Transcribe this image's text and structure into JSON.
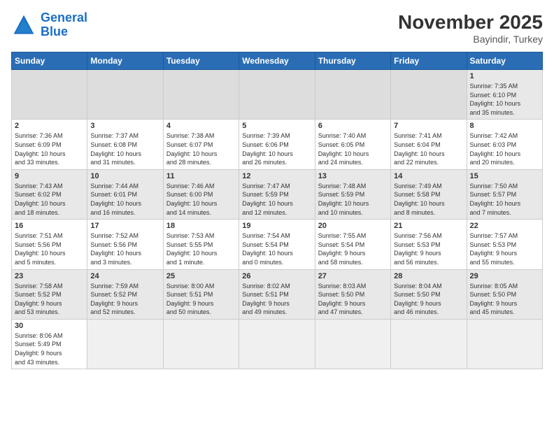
{
  "header": {
    "logo_general": "General",
    "logo_blue": "Blue",
    "month_title": "November 2025",
    "location": "Bayindir, Turkey"
  },
  "days_of_week": [
    "Sunday",
    "Monday",
    "Tuesday",
    "Wednesday",
    "Thursday",
    "Friday",
    "Saturday"
  ],
  "weeks": [
    [
      {
        "day": "",
        "info": ""
      },
      {
        "day": "",
        "info": ""
      },
      {
        "day": "",
        "info": ""
      },
      {
        "day": "",
        "info": ""
      },
      {
        "day": "",
        "info": ""
      },
      {
        "day": "",
        "info": ""
      },
      {
        "day": "1",
        "info": "Sunrise: 7:35 AM\nSunset: 6:10 PM\nDaylight: 10 hours\nand 35 minutes."
      }
    ],
    [
      {
        "day": "2",
        "info": "Sunrise: 7:36 AM\nSunset: 6:09 PM\nDaylight: 10 hours\nand 33 minutes."
      },
      {
        "day": "3",
        "info": "Sunrise: 7:37 AM\nSunset: 6:08 PM\nDaylight: 10 hours\nand 31 minutes."
      },
      {
        "day": "4",
        "info": "Sunrise: 7:38 AM\nSunset: 6:07 PM\nDaylight: 10 hours\nand 28 minutes."
      },
      {
        "day": "5",
        "info": "Sunrise: 7:39 AM\nSunset: 6:06 PM\nDaylight: 10 hours\nand 26 minutes."
      },
      {
        "day": "6",
        "info": "Sunrise: 7:40 AM\nSunset: 6:05 PM\nDaylight: 10 hours\nand 24 minutes."
      },
      {
        "day": "7",
        "info": "Sunrise: 7:41 AM\nSunset: 6:04 PM\nDaylight: 10 hours\nand 22 minutes."
      },
      {
        "day": "8",
        "info": "Sunrise: 7:42 AM\nSunset: 6:03 PM\nDaylight: 10 hours\nand 20 minutes."
      }
    ],
    [
      {
        "day": "9",
        "info": "Sunrise: 7:43 AM\nSunset: 6:02 PM\nDaylight: 10 hours\nand 18 minutes."
      },
      {
        "day": "10",
        "info": "Sunrise: 7:44 AM\nSunset: 6:01 PM\nDaylight: 10 hours\nand 16 minutes."
      },
      {
        "day": "11",
        "info": "Sunrise: 7:46 AM\nSunset: 6:00 PM\nDaylight: 10 hours\nand 14 minutes."
      },
      {
        "day": "12",
        "info": "Sunrise: 7:47 AM\nSunset: 5:59 PM\nDaylight: 10 hours\nand 12 minutes."
      },
      {
        "day": "13",
        "info": "Sunrise: 7:48 AM\nSunset: 5:59 PM\nDaylight: 10 hours\nand 10 minutes."
      },
      {
        "day": "14",
        "info": "Sunrise: 7:49 AM\nSunset: 5:58 PM\nDaylight: 10 hours\nand 8 minutes."
      },
      {
        "day": "15",
        "info": "Sunrise: 7:50 AM\nSunset: 5:57 PM\nDaylight: 10 hours\nand 7 minutes."
      }
    ],
    [
      {
        "day": "16",
        "info": "Sunrise: 7:51 AM\nSunset: 5:56 PM\nDaylight: 10 hours\nand 5 minutes."
      },
      {
        "day": "17",
        "info": "Sunrise: 7:52 AM\nSunset: 5:56 PM\nDaylight: 10 hours\nand 3 minutes."
      },
      {
        "day": "18",
        "info": "Sunrise: 7:53 AM\nSunset: 5:55 PM\nDaylight: 10 hours\nand 1 minute."
      },
      {
        "day": "19",
        "info": "Sunrise: 7:54 AM\nSunset: 5:54 PM\nDaylight: 10 hours\nand 0 minutes."
      },
      {
        "day": "20",
        "info": "Sunrise: 7:55 AM\nSunset: 5:54 PM\nDaylight: 9 hours\nand 58 minutes."
      },
      {
        "day": "21",
        "info": "Sunrise: 7:56 AM\nSunset: 5:53 PM\nDaylight: 9 hours\nand 56 minutes."
      },
      {
        "day": "22",
        "info": "Sunrise: 7:57 AM\nSunset: 5:53 PM\nDaylight: 9 hours\nand 55 minutes."
      }
    ],
    [
      {
        "day": "23",
        "info": "Sunrise: 7:58 AM\nSunset: 5:52 PM\nDaylight: 9 hours\nand 53 minutes."
      },
      {
        "day": "24",
        "info": "Sunrise: 7:59 AM\nSunset: 5:52 PM\nDaylight: 9 hours\nand 52 minutes."
      },
      {
        "day": "25",
        "info": "Sunrise: 8:00 AM\nSunset: 5:51 PM\nDaylight: 9 hours\nand 50 minutes."
      },
      {
        "day": "26",
        "info": "Sunrise: 8:02 AM\nSunset: 5:51 PM\nDaylight: 9 hours\nand 49 minutes."
      },
      {
        "day": "27",
        "info": "Sunrise: 8:03 AM\nSunset: 5:50 PM\nDaylight: 9 hours\nand 47 minutes."
      },
      {
        "day": "28",
        "info": "Sunrise: 8:04 AM\nSunset: 5:50 PM\nDaylight: 9 hours\nand 46 minutes."
      },
      {
        "day": "29",
        "info": "Sunrise: 8:05 AM\nSunset: 5:50 PM\nDaylight: 9 hours\nand 45 minutes."
      }
    ],
    [
      {
        "day": "30",
        "info": "Sunrise: 8:06 AM\nSunset: 5:49 PM\nDaylight: 9 hours\nand 43 minutes."
      },
      {
        "day": "",
        "info": ""
      },
      {
        "day": "",
        "info": ""
      },
      {
        "day": "",
        "info": ""
      },
      {
        "day": "",
        "info": ""
      },
      {
        "day": "",
        "info": ""
      },
      {
        "day": "",
        "info": ""
      }
    ]
  ]
}
